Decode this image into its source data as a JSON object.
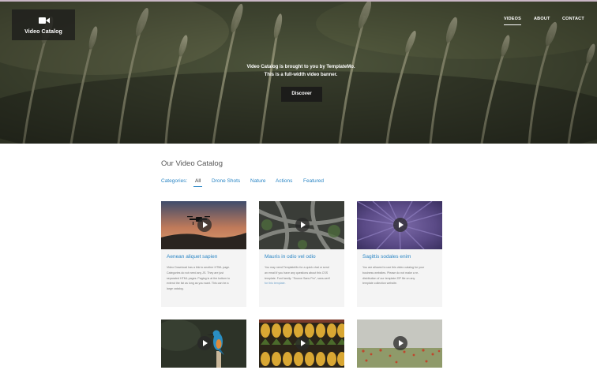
{
  "hero": {
    "brand": "Video Catalog",
    "nav": [
      "VIDEOS",
      "ABOUT",
      "CONTACT"
    ],
    "line1": "Video Catalog is brought to you by TemplateMo.",
    "line2": "This is a full-width video banner.",
    "button": "Discover"
  },
  "catalog": {
    "title": "Our Video Catalog",
    "categories_label": "Categories:",
    "categories": [
      "All",
      "Drone Shots",
      "Nature",
      "Actions",
      "Featured"
    ],
    "active_category": "All"
  },
  "cards": [
    {
      "title": "Aenean aliquet sapien",
      "desc": [
        "Video Download has a link to another HTML page.",
        "Categories do not need any JS. They are just",
        "separated HTML pages. Paging is at the bottom to",
        "extend the list as long as you want. This can be a",
        "large catalog."
      ]
    },
    {
      "title": "Mauris in odio vel odio",
      "desc": [
        "You may need TemplateMo for a quick chat or send",
        "an email if you have any questions about this CSS",
        "template. Font family: \"Source Sans Pro\", sans-serif"
      ],
      "desc_link": "for this template."
    },
    {
      "title": "Sagittis sodales enim",
      "desc": [
        "You are allowed to use this video catalog for your",
        "business websites. Please do not make a re-",
        "distribution of our template ZIP file on any",
        "template collection website."
      ]
    },
    {
      "title": "",
      "desc": []
    },
    {
      "title": "",
      "desc": []
    },
    {
      "title": "",
      "desc": []
    }
  ],
  "colors": {
    "accent": "#2b86c5",
    "card_bg": "#f4f4f4",
    "hero_dark": "#1c1c1a"
  },
  "icons": {
    "brand": "video-camera-icon",
    "play": "play-circle-icon"
  }
}
